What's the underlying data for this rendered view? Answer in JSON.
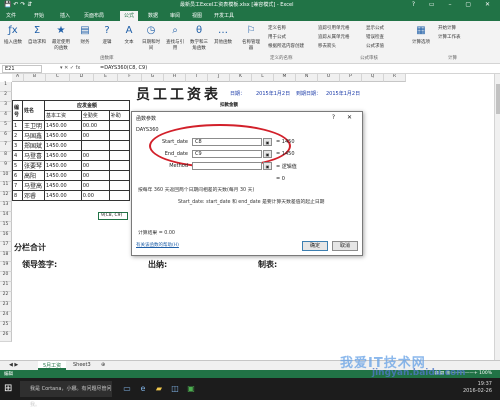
{
  "titlebar": {
    "title": "最新员工Excel工资表模板.xlsx [兼容模式] - Excel",
    "quick_access": "💾 ↶ ↷ ⇵",
    "window_controls": "? ▭ – ▢ ✕"
  },
  "ribbon_tabs": [
    "文件",
    "开始",
    "插入",
    "页面布局",
    "公式",
    "数据",
    "审阅",
    "视图",
    "开发工具"
  ],
  "active_tab": "公式",
  "ribbon": {
    "buttons": [
      "插入函数",
      "自动求和",
      "最近使用的函数",
      "财务",
      "逻辑",
      "文本",
      "日期和时间",
      "查找与引用",
      "数学和三角函数",
      "其他函数",
      "名称管理器",
      "计算选项"
    ],
    "small_items": [
      "定义名称",
      "用于公式",
      "根据所选内容创建",
      "追踪引用单元格",
      "追踪从属单元格",
      "移去箭头",
      "显示公式",
      "错误检查",
      "公式求值",
      "开始计算",
      "计算工作表"
    ],
    "groups": [
      "函数库",
      "定义的名称",
      "公式审核",
      "计算"
    ]
  },
  "formula_bar": {
    "name_box": "E21",
    "icons": "▾  ✕  ✓  fx",
    "formula": "=DAYS360(C8, C9)"
  },
  "columns": [
    "A",
    "B",
    "C",
    "D",
    "E",
    "F",
    "G",
    "H",
    "I",
    "J",
    "K",
    "L",
    "M",
    "N",
    "O",
    "P",
    "Q",
    "R"
  ],
  "rows": [
    "1",
    "2",
    "3",
    "4",
    "5",
    "6",
    "7",
    "8",
    "9",
    "10",
    "11",
    "12",
    "13",
    "14",
    "15",
    "16",
    "17",
    "18",
    "19",
    "20",
    "21",
    "22",
    "23",
    "24",
    "25",
    "26"
  ],
  "sheet": {
    "title": "员工工资表",
    "date_label": "日期：",
    "date_value": "2015年1月2日",
    "due_label": "到期日期：",
    "due_value": "2015年1月2日",
    "h_no": "编号",
    "h_name": "姓名",
    "h_due": "应发金额",
    "h_deduct": "扣款金额",
    "h_base": "基本工资",
    "h_full": "全勤奖",
    "h_subsidy": "补助",
    "rows": [
      {
        "no": "1",
        "name": "王卫明",
        "base": "1450.00",
        "full": "00.00"
      },
      {
        "no": "2",
        "name": "马国鑫",
        "base": "1450.00",
        "full": "00"
      },
      {
        "no": "3",
        "name": "郑国斌",
        "base": "1450.00",
        "full": ""
      },
      {
        "no": "4",
        "name": "马登喜",
        "base": "1450.00",
        "full": "00"
      },
      {
        "no": "5",
        "name": "张要琴",
        "base": "1450.00",
        "full": "00"
      },
      {
        "no": "6",
        "name": "高阳",
        "base": "1450.00",
        "full": "00"
      },
      {
        "no": "7",
        "name": "马登高",
        "base": "1450.00",
        "full": "00"
      },
      {
        "no": "8",
        "name": "邓睿",
        "base": "1450.00",
        "full": "0.00"
      }
    ],
    "total_label": "分栏合计",
    "sign_leader": "领导签字:",
    "sign_cashier": "出纳:",
    "sign_maker": "制表:",
    "selected_cell": "9(C8, C9)"
  },
  "dialog": {
    "title": "函数参数",
    "function_name": "DAYS360",
    "args": [
      {
        "label": "Start_date",
        "value": "C8",
        "result": "= 1450"
      },
      {
        "label": "End_date",
        "value": "C9",
        "result": "= 1450"
      },
      {
        "label": "Method",
        "value": "",
        "result": "= 逻辑值"
      }
    ],
    "result_eq": "= 0",
    "description": "按每年 360 天返回两个日期间相差的天数(每月 30 天)",
    "arg_help": "Start_date:  start_date 和 end_date 是要计算天数差值的起止日期",
    "calc_result": "计算结果 =   0.00",
    "help_link": "有关该函数的帮助(H)",
    "ok": "确定",
    "cancel": "取消",
    "controls": "?  ✕"
  },
  "sheet_tabs": [
    "5月工资",
    "Sheet3"
  ],
  "active_sheet": "5月工资",
  "status": {
    "left": "编辑",
    "right": "▦ ▤ ▥  —————+  100%"
  },
  "taskbar": {
    "search_placeholder": "我是 Cortana，小娜。有问题尽管问我。",
    "time": "19:37",
    "date": "2016-02-26"
  },
  "watermark": "我爱IT技术网",
  "watermark_url": "jingyan.baidu.com"
}
